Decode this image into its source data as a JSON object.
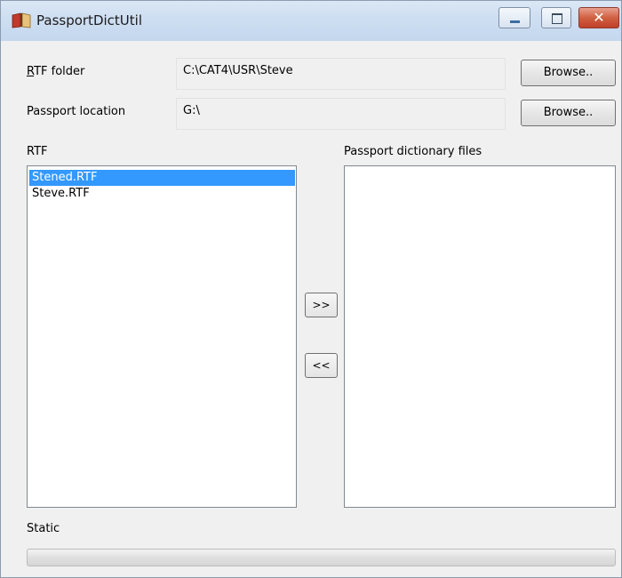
{
  "window": {
    "title": "PassportDictUtil",
    "close_glyph": "✕"
  },
  "form": {
    "rtf_folder_label": "RTF folder",
    "rtf_folder_value": "C:\\CAT4\\USR\\Steve",
    "passport_location_label": "Passport location",
    "passport_location_value": "G:\\",
    "browse_label_1": "Browse..",
    "browse_label_2": "Browse.."
  },
  "rtf_list": {
    "heading": "RTF",
    "items": [
      "Stened.RTF",
      "Steve.RTF"
    ],
    "selected_index": 0
  },
  "passport_list": {
    "heading": "Passport dictionary files",
    "items": []
  },
  "actions": {
    "add_label": ">>",
    "remove_label": "<<"
  },
  "status": {
    "text": "Static",
    "progress": 0
  }
}
